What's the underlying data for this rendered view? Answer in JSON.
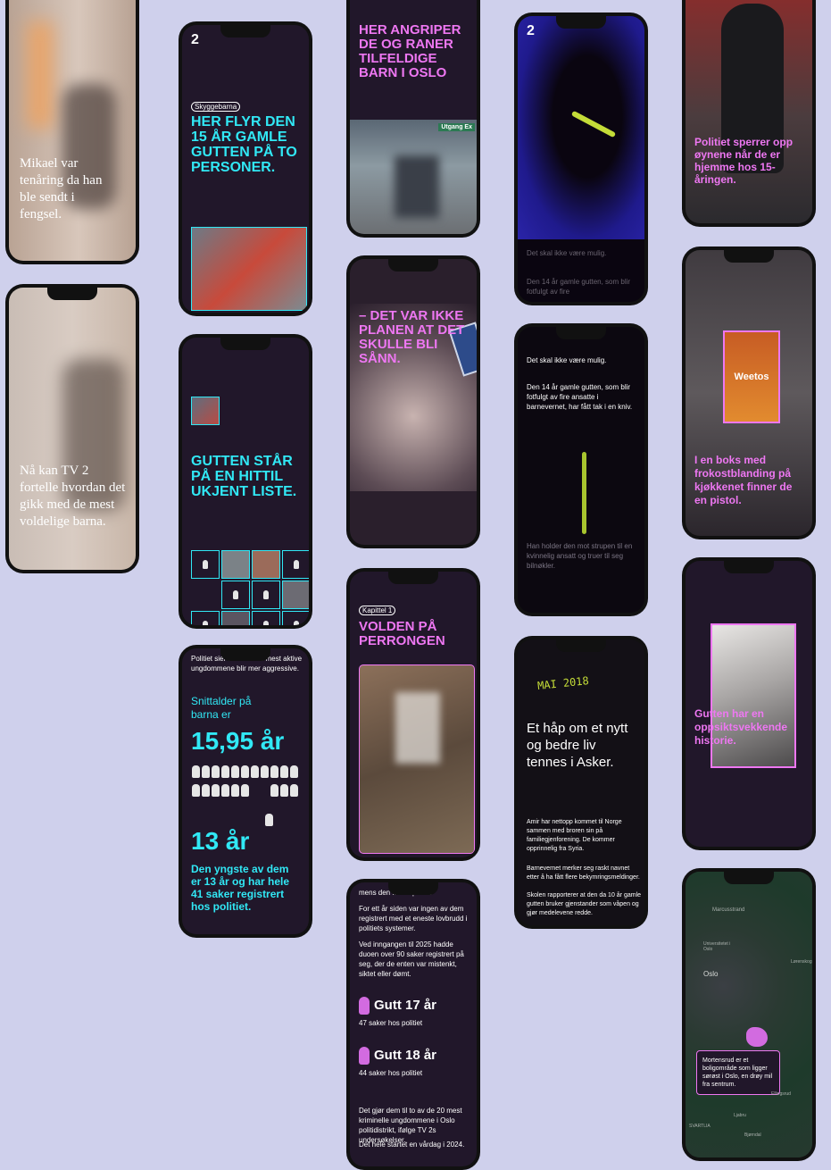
{
  "logo": "2",
  "phone1": {
    "text": "Mikael var tenåring da han ble sendt i fengsel."
  },
  "phone2": {
    "text": "Nå kan TV 2 fortelle hvordan det gikk med de mest voldelige barna."
  },
  "phone3": {
    "kicker": "Skyggebarna",
    "headline": "HER FLYR DEN 15 ÅR GAMLE GUTTEN PÅ TO PERSONER."
  },
  "phone4": {
    "headline": "GUTTEN STÅR PÅ EN HITTIL UKJENT LISTE."
  },
  "phone5": {
    "intro": "Politiet sier ... ver at de mest aktive ungdommene blir mer aggressive.",
    "label": "Snittalder på barna er",
    "avg": "15,95 år",
    "youngest": "13 år",
    "youngest_desc": "Den yngste av dem er 13 år og har hele 41 saker registrert hos politiet."
  },
  "phone6": {
    "headline": "HER ANGRIPER DE OG RANER TILFELDIGE BARN I OSLO",
    "sign": "Utgang Ex"
  },
  "phone7": {
    "headline": "– DET VAR IKKE PLANEN AT DET SKULLE BLI SÅNN."
  },
  "phone8": {
    "kicker": "Kapittel 1",
    "headline": "VOLDEN PÅ PERRONGEN"
  },
  "phone9": {
    "intro": "mens den ... t i Spania.",
    "p1": "For ett år siden var ingen av dem registrert med et eneste lovbrudd i politiets systemer.",
    "p2": "Ved inngangen til 2025 hadde duoen over 90 saker registrert på seg, der de enten var mistenkt, siktet eller dømt.",
    "boy1": "Gutt 17 år",
    "boy1_cases": "47 saker hos politiet",
    "boy2": "Gutt 18 år",
    "boy2_cases": "44 saker hos politiet",
    "p3": "Det gjør dem til to av de 20 mest kriminelle ungdommene i Oslo politidistrikt, ifølge TV 2s undersøkelser.",
    "p4": "Det hele startet en vårdag i 2024."
  },
  "phone10": {
    "faded1": "Det skal ikke være mulig.",
    "faded2": "Den 14 år gamle gutten, som blir fotfulgt av fire"
  },
  "phone11": {
    "p1": "Det skal ikke være mulig.",
    "p2": "Den 14 år gamle gutten, som blir fotfulgt av fire ansatte i barnevernet, har fått tak i en kniv.",
    "p3": "Han holder den mot strupen til en kvinnelig ansatt og truer til seg bilnøkler."
  },
  "phone12": {
    "handwriting": "MAI 2018",
    "headline": "Et håp om et nytt og bedre liv tennes i Asker.",
    "p1": "Amir har nettopp kommet til Norge sammen med broren sin på familiegjenforening. De kommer opprinnelig fra Syria.",
    "p2": "Barnevernet merker seg raskt navnet etter å ha fått flere bekymringsmeldinger.",
    "p3": "Skolen rapporterer at den da 10 år gamle gutten bruker gjenstander som våpen og gjør medelevene redde."
  },
  "phone13": {
    "text": "Politiet sperrer opp øynene når de er hjemme hos 15-åringen."
  },
  "phone14": {
    "box": "Weetos",
    "text": "I en boks med frokostblanding på kjøkkenet finner de en pistol."
  },
  "phone15": {
    "text": "Gutten har en oppsiktsvekkende historie."
  },
  "phone16": {
    "labels": {
      "top": "Marcusstrand",
      "uni": "Universitetet i Oslo",
      "city": "Oslo",
      "east": "Lørenskog",
      "south": "Ljabru",
      "far": "Bjørndal",
      "bottom": "SVARTLIA",
      "right": "Ellingsrud"
    },
    "text": "Mortensrud er et boligområde som ligger sørøst i Oslo, en drøy mil fra sentrum."
  }
}
